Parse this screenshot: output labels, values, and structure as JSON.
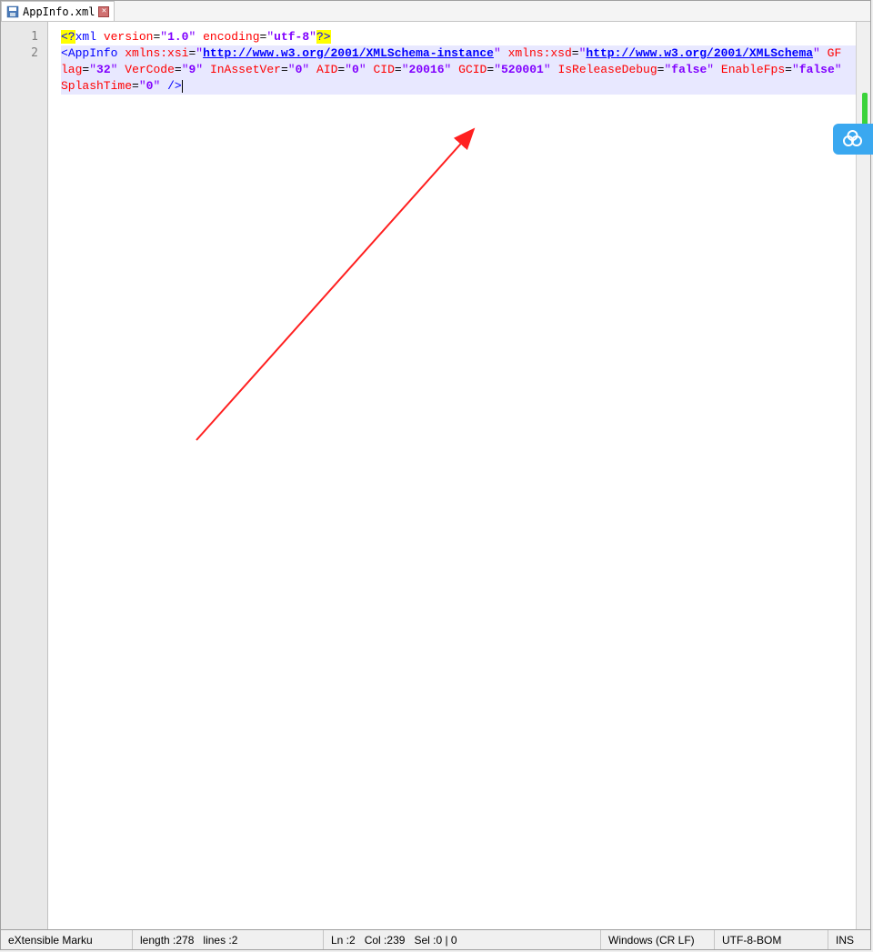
{
  "tab": {
    "filename": "AppInfo.xml"
  },
  "gutter": {
    "lines": [
      "1",
      "2"
    ]
  },
  "code": {
    "line1": {
      "open": "<?",
      "tag": "xml",
      "attr1_name": "version",
      "attr1_val": "1.0",
      "attr2_name": "encoding",
      "attr2_val": "utf-8",
      "close": "?>"
    },
    "line2": {
      "open": "<",
      "tag": "AppInfo",
      "xmlns_xsi_name": "xmlns:xsi",
      "xmlns_xsi_val": "http://www.w3.org/2001/XMLSchema-instance",
      "xmlns_xsd_name": "xmlns:xsd",
      "xmlns_xsd_val": "http://www.w3.org/2001/XMLSchema",
      "gflag_name": "GFlag",
      "gflag_val": "32",
      "vercode_name": "VerCode",
      "vercode_val": "9",
      "inassetver_name": "InAssetVer",
      "inassetver_val": "0",
      "aid_name": "AID",
      "aid_val": "0",
      "cid_name": "CID",
      "cid_val": "20016",
      "gcid_name": "GCID",
      "gcid_val": "520001",
      "isreleasedebug_name": "IsReleaseDebug",
      "isreleasedebug_val": "false",
      "enablefps_name": "EnableFps",
      "enablefps_val": "false",
      "splashtime_name": "SplashTime",
      "splashtime_val": "0",
      "close": "/>"
    }
  },
  "status": {
    "lang": "eXtensible Marku",
    "length_label": "length : ",
    "length_val": "278",
    "lines_label": "lines : ",
    "lines_val": "2",
    "ln_label": "Ln : ",
    "ln_val": "2",
    "col_label": "Col : ",
    "col_val": "239",
    "sel_label": "Sel : ",
    "sel_val": "0 | 0",
    "eol": "Windows (CR LF)",
    "encoding": "UTF-8-BOM",
    "ins": "INS"
  }
}
